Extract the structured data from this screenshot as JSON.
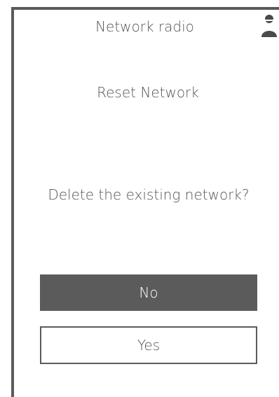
{
  "header": {
    "title": "Network radio",
    "icon": "user-icon"
  },
  "screen": {
    "title": "Reset Network",
    "question": "Delete the existing network?"
  },
  "buttons": {
    "no_label": "No",
    "yes_label": "Yes"
  },
  "colors": {
    "frame": "#5b5b5b",
    "text": "#555555",
    "primary_button_bg": "#5b5b5b",
    "primary_button_text": "#ffffff"
  }
}
